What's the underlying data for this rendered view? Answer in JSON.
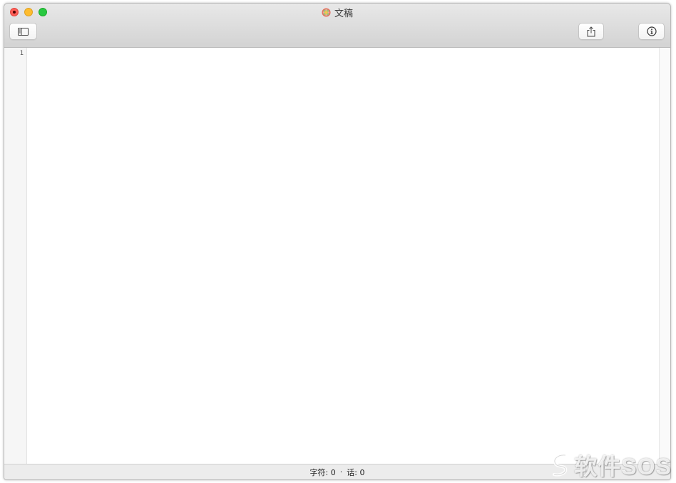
{
  "window": {
    "title": "文稿",
    "doc_icon": "document-flower-icon"
  },
  "toolbar": {
    "sidebar_icon": "sidebar-toggle-icon",
    "share_icon": "share-icon",
    "info_icon": "info-icon"
  },
  "editor": {
    "line_numbers": [
      "1"
    ],
    "content": ""
  },
  "status": {
    "chars_label": "字符: 0",
    "separator": "·",
    "words_label": "话: 0"
  },
  "watermark": {
    "text": "软件SOS"
  },
  "colors": {
    "close": "#ff5f57",
    "minimize": "#febc2e",
    "maximize": "#28c840"
  }
}
